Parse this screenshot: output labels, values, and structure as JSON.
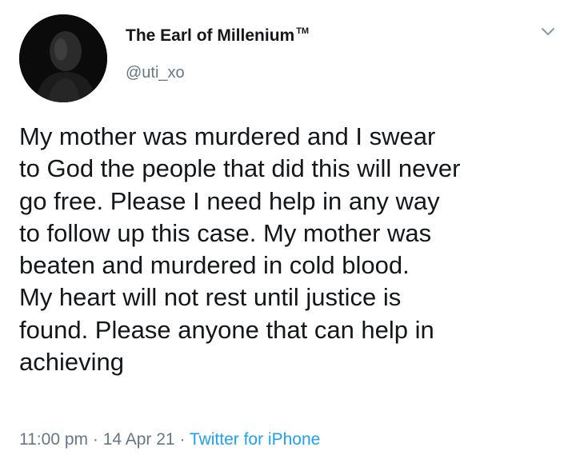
{
  "author": {
    "display_name": "The Earl of Millenium",
    "trademark": "TM",
    "handle": "@uti_xo",
    "avatar_icon": "profile-photo"
  },
  "tweet": {
    "lines": [
      "My mother was murdered and I swear",
      "to God the people that did this will never",
      "go free. Please I need help in any way",
      "to follow up this case. My mother was",
      "beaten and murdered in cold blood.",
      "My heart will not rest until justice is",
      "found. Please anyone that can help in",
      "achieving"
    ],
    "time": "11:00 pm",
    "separator": "·",
    "date": "14 Apr 21",
    "source": "Twitter for iPhone"
  },
  "colors": {
    "text": "#14171a",
    "secondary": "#657786",
    "link": "#1da1f2"
  },
  "icons": {
    "menu": "chevron-down-icon"
  }
}
